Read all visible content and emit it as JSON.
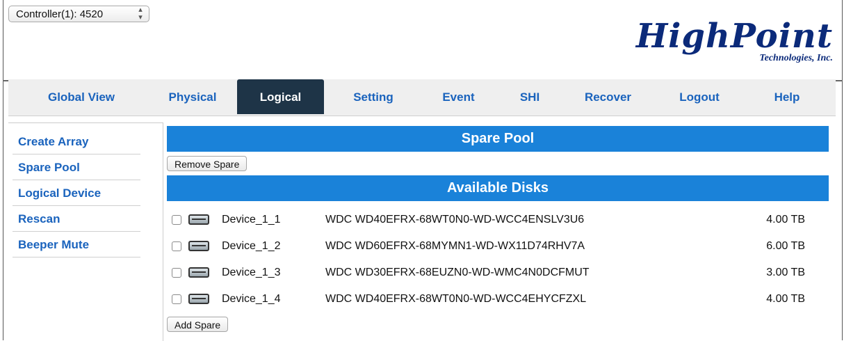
{
  "controller": {
    "label": "Controller(1): 4520"
  },
  "logo": {
    "name": "HighPoint",
    "subtitle": "Technologies, Inc."
  },
  "nav": {
    "items": [
      {
        "label": "Global View"
      },
      {
        "label": "Physical"
      },
      {
        "label": "Logical"
      },
      {
        "label": "Setting"
      },
      {
        "label": "Event"
      },
      {
        "label": "SHI"
      },
      {
        "label": "Recover"
      },
      {
        "label": "Logout"
      },
      {
        "label": "Help"
      }
    ],
    "active": "Logical"
  },
  "sidebar": {
    "items": [
      {
        "label": "Create Array"
      },
      {
        "label": "Spare Pool"
      },
      {
        "label": "Logical Device"
      },
      {
        "label": "Rescan"
      },
      {
        "label": "Beeper Mute"
      }
    ]
  },
  "spare_pool": {
    "title": "Spare Pool",
    "remove_button": "Remove Spare"
  },
  "available_disks": {
    "title": "Available Disks",
    "add_button": "Add Spare",
    "rows": [
      {
        "device": "Device_1_1",
        "model": "WDC WD40EFRX-68WT0N0-WD-WCC4ENSLV3U6",
        "size": "4.00 TB"
      },
      {
        "device": "Device_1_2",
        "model": "WDC WD60EFRX-68MYMN1-WD-WX11D74RHV7A",
        "size": "6.00 TB"
      },
      {
        "device": "Device_1_3",
        "model": "WDC WD30EFRX-68EUZN0-WD-WMC4N0DCFMUT",
        "size": "3.00 TB"
      },
      {
        "device": "Device_1_4",
        "model": "WDC WD40EFRX-68WT0N0-WD-WCC4EHYCFZXL",
        "size": "4.00 TB"
      }
    ]
  },
  "colors": {
    "accent_blue": "#1a82d9",
    "link_blue": "#1a63bd",
    "active_tab": "#1e3447",
    "logo_blue": "#0b2a7a"
  }
}
